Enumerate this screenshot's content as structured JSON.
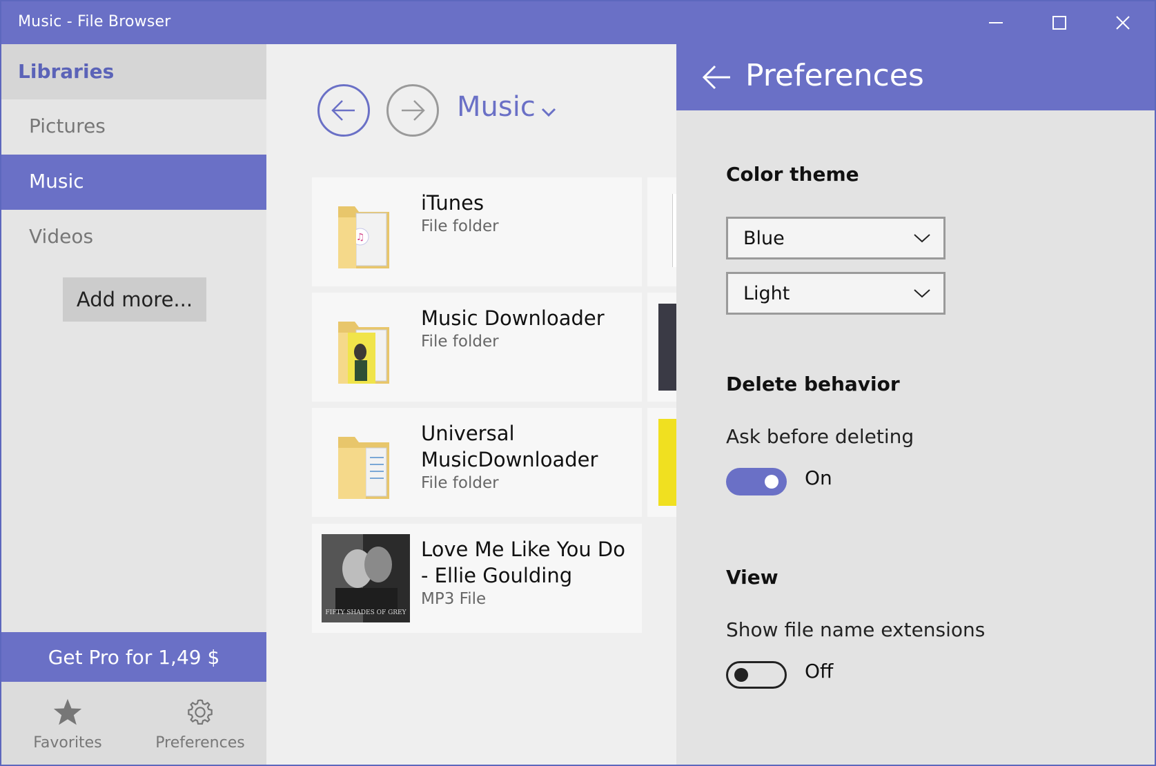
{
  "window": {
    "title": "Music - File Browser"
  },
  "sidebar": {
    "header": "Libraries",
    "items": [
      {
        "label": "Pictures"
      },
      {
        "label": "Music"
      },
      {
        "label": "Videos"
      }
    ],
    "add_more": "Add more...",
    "get_pro": "Get Pro for 1,49 $",
    "bottom_nav": [
      {
        "label": "Favorites",
        "icon": "star-icon"
      },
      {
        "label": "Preferences",
        "icon": "gear-icon"
      }
    ]
  },
  "main": {
    "location": "Music",
    "files": [
      {
        "name": "iTunes",
        "type": "File folder",
        "icon": "folder-icon"
      },
      {
        "name": "Music Downloader",
        "type": "File folder",
        "icon": "folder-icon"
      },
      {
        "name": "Universal MusicDownloader",
        "type": "File folder",
        "icon": "folder-icon"
      },
      {
        "name": "Love Me Like You Do - Ellie Goulding",
        "type": "MP3 File",
        "icon": "album-art",
        "thumb_caption": "FIFTY SHADES OF GREY"
      }
    ]
  },
  "preferences": {
    "title": "Preferences",
    "color_theme": {
      "title": "Color theme",
      "accent": "Blue",
      "mode": "Light"
    },
    "delete_behavior": {
      "title": "Delete behavior",
      "ask_label": "Ask before deleting",
      "ask_state": "On"
    },
    "view": {
      "title": "View",
      "ext_label": "Show file name extensions",
      "ext_state": "Off"
    }
  },
  "colors": {
    "accent": "#6a70c6",
    "sidebar_bg": "#e5e5e5",
    "panel_bg": "#e3e3e3"
  }
}
